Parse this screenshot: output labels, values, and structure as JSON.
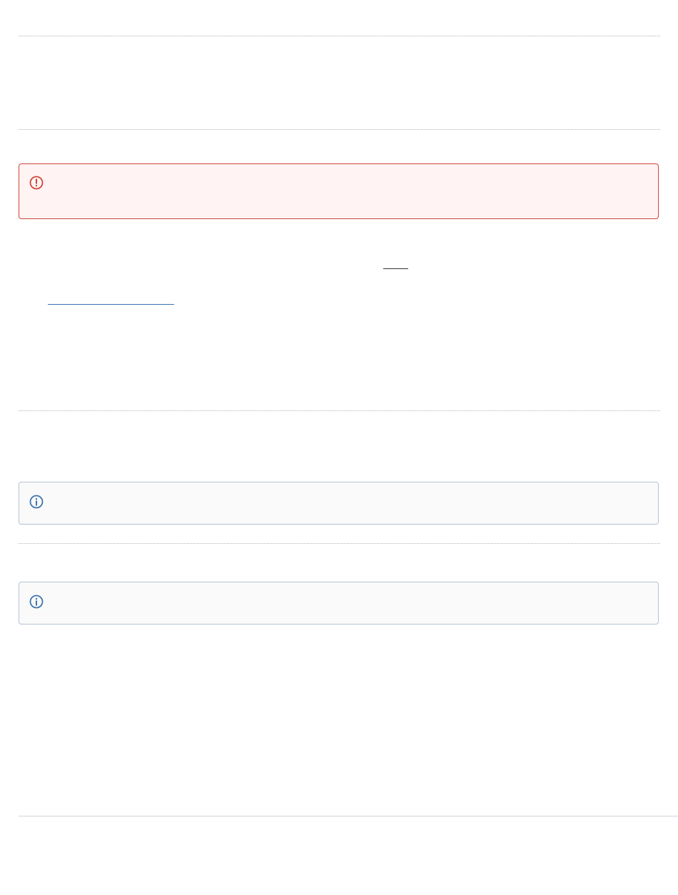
{
  "panels": {
    "error": {
      "icon": "error-exclamation-icon",
      "color": "#d04437",
      "background": "#fff4f3"
    },
    "info_1": {
      "icon": "info-icon",
      "color": "#3b73af",
      "background": "#fafafa"
    },
    "info_2": {
      "icon": "info-icon",
      "color": "#3b73af",
      "background": "#fafafa"
    }
  },
  "colors": {
    "link": "#3b73af",
    "rule": "#b3b3b3",
    "footer_rule": "#d0d4da"
  }
}
